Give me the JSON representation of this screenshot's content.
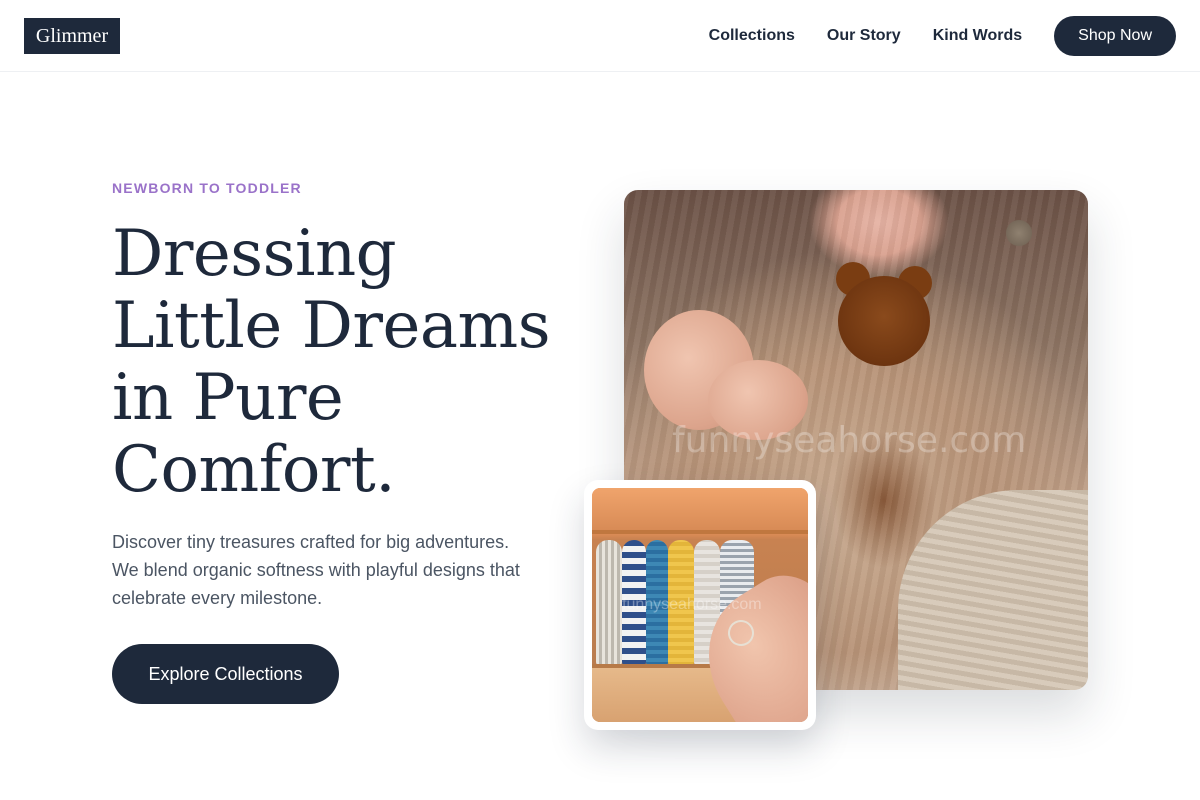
{
  "header": {
    "logo": "Glimmer",
    "nav": [
      "Collections",
      "Our Story",
      "Kind Words"
    ],
    "cta": "Shop Now"
  },
  "hero": {
    "eyebrow": "NEWBORN TO TODDLER",
    "headline_lines": [
      "Dressing",
      "Little Dreams",
      "in Pure",
      "Comfort."
    ],
    "lead_lines": [
      "Discover tiny treasures crafted for big adventures.",
      "We blend organic softness with playful designs that",
      "celebrate every milestone."
    ],
    "button": "Explore Collections"
  },
  "images": {
    "main_alt_watermark": "funnyseahorse.com",
    "small_alt_watermark": "funnyseahorse.com"
  },
  "colors": {
    "brand": "#1e293b",
    "accent": "#9a72c9",
    "body_text": "#4b5563"
  }
}
